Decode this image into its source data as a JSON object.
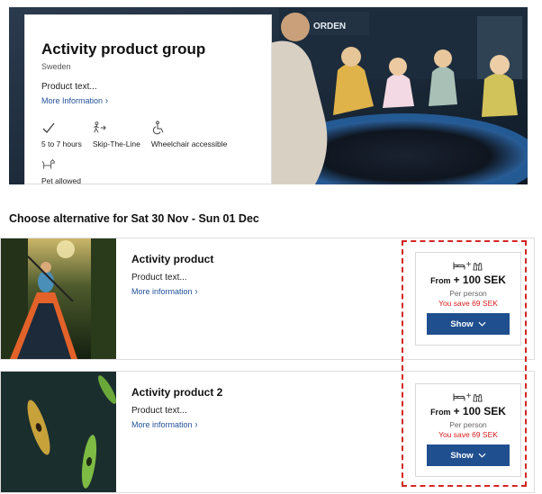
{
  "hero": {
    "title": "Activity product group",
    "country": "Sweden",
    "text": "Product text...",
    "more_info_label": "More Information",
    "features": [
      {
        "icon": "check-icon",
        "label": "5 to 7 hours"
      },
      {
        "icon": "skip-the-line-icon",
        "label": "Skip-The-Line"
      },
      {
        "icon": "wheelchair-icon",
        "label": "Wheelchair accessible"
      },
      {
        "icon": "dog-icon",
        "label": "Pet allowed"
      }
    ],
    "photo_sign": "ORDEN"
  },
  "section": {
    "heading": "Choose alternative for Sat 30 Nov - Sun 01 Dec"
  },
  "products": [
    {
      "title": "Activity product",
      "text": "Product text...",
      "more_info_label": "More information",
      "plus": "+",
      "from_label": "From",
      "price": "+ 100 SEK",
      "per_person": "Per person",
      "savings": "You save 69 SEK",
      "button_label": "Show"
    },
    {
      "title": "Activity product 2",
      "text": "Product text...",
      "more_info_label": "More information",
      "plus": "+",
      "from_label": "From",
      "price": "+ 100 SEK",
      "per_person": "Per person",
      "savings": "You save 69 SEK",
      "button_label": "Show"
    }
  ],
  "colors": {
    "primary_button": "#1f4f8f",
    "link": "#23519a",
    "savings": "#d62020",
    "highlight": "#d42525"
  }
}
